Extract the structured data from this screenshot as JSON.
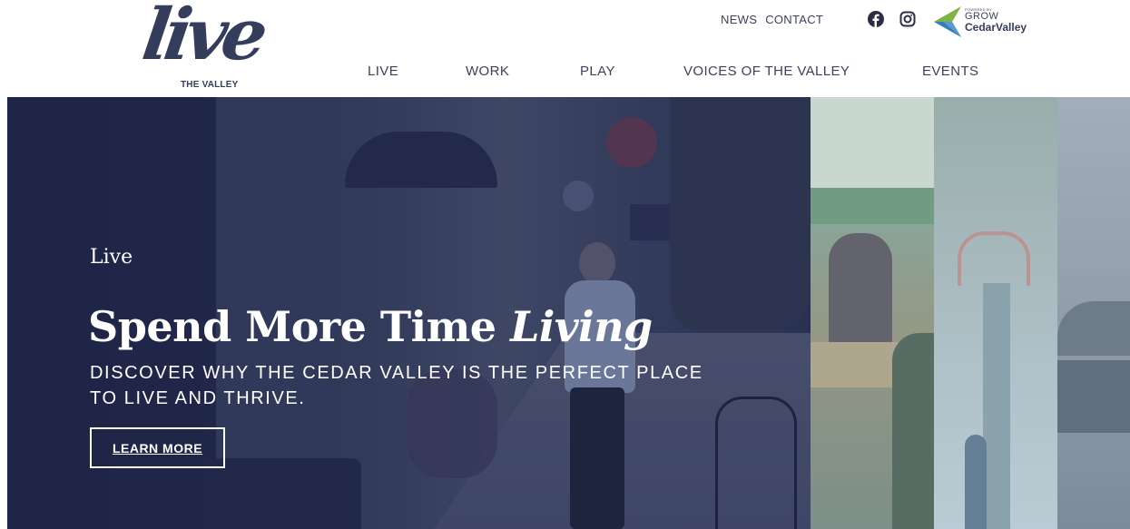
{
  "logo": {
    "script": "live",
    "subtitle": "THE VALLEY"
  },
  "utility_nav": {
    "items": [
      "NEWS",
      "CONTACT"
    ]
  },
  "social": {
    "facebook": "facebook-icon",
    "instagram": "instagram-icon"
  },
  "partner_logo": {
    "powered_by": "POWERED BY",
    "grow": "GROW",
    "cedar_valley": "CedarValley"
  },
  "main_nav": {
    "items": [
      "LIVE",
      "WORK",
      "PLAY",
      "VOICES OF THE VALLEY",
      "EVENTS"
    ]
  },
  "hero": {
    "eyebrow": "Live",
    "title_plain": "Spend More Time ",
    "title_italic": "Living",
    "subtitle": "DISCOVER WHY THE CEDAR VALLEY IS THE PERFECT PLACE TO LIVE AND THRIVE.",
    "button_label": "LEARN MORE"
  },
  "colors": {
    "brand_navy": "#353d5c",
    "nav_text": "#3c4160",
    "partner_green": "#7fb342",
    "partner_blue": "#2f7fb8"
  }
}
